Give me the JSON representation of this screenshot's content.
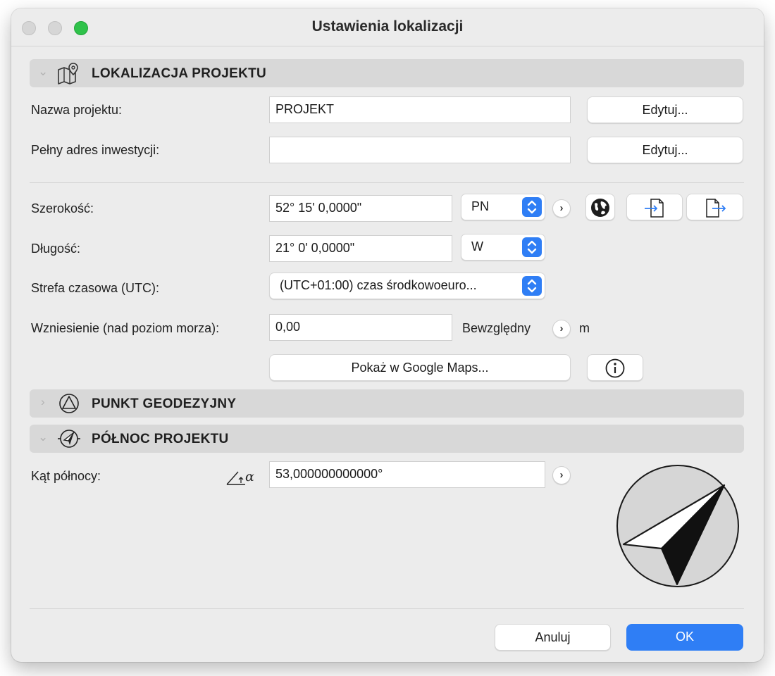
{
  "window": {
    "title": "Ustawienia lokalizacji"
  },
  "sections": {
    "location": {
      "title": "LOKALIZACJA PROJEKTU"
    },
    "survey_point": {
      "title": "PUNKT GEODEZYJNY"
    },
    "project_north": {
      "title": "PÓŁNOC PROJEKTU"
    }
  },
  "project": {
    "name_label": "Nazwa projektu:",
    "name_value": "PROJEKT",
    "name_edit": "Edytuj...",
    "address_label": "Pełny adres inwestycji:",
    "address_value": "",
    "address_edit": "Edytuj..."
  },
  "coords": {
    "latitude_label": "Szerokość:",
    "latitude_value": "52° 15' 0,0000\"",
    "latitude_dir": "PN",
    "longitude_label": "Długość:",
    "longitude_value": "21° 0' 0,0000\"",
    "longitude_dir": "W",
    "timezone_label": "Strefa czasowa (UTC):",
    "timezone_value": "(UTC+01:00) czas środkowoeuro...",
    "elevation_label": "Wzniesienie (nad poziom morza):",
    "elevation_value": "0,00",
    "elevation_ref": "Bewzględny",
    "elevation_unit": "m",
    "google_maps": "Pokaż w Google Maps..."
  },
  "north": {
    "angle_label": "Kąt północy:",
    "angle_value": "53,000000000000°",
    "angle_symbol": "α"
  },
  "footer": {
    "cancel": "Anuluj",
    "ok": "OK"
  },
  "colors": {
    "accent": "#2f7ef5",
    "section_bg": "#d8d8d8",
    "window_bg": "#ececec"
  }
}
